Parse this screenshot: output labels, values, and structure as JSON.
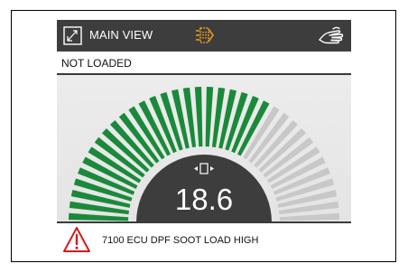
{
  "header": {
    "title": "MAIN VIEW",
    "icons": [
      "main-view-icon",
      "dpf-regen-icon",
      "touch-hand-icon"
    ]
  },
  "status": {
    "text": "NOT LOADED"
  },
  "gauge": {
    "value": "18.6",
    "fill_fraction": 0.67,
    "segments": 36,
    "filled_color": "#1a8a3a",
    "empty_color": "#c8c8c8",
    "icon": "filter-icon"
  },
  "alert": {
    "icon": "warning-triangle-icon",
    "message": "7100  ECU DPF SOOT LOAD HIGH",
    "icon_color": "#d41a1a"
  }
}
